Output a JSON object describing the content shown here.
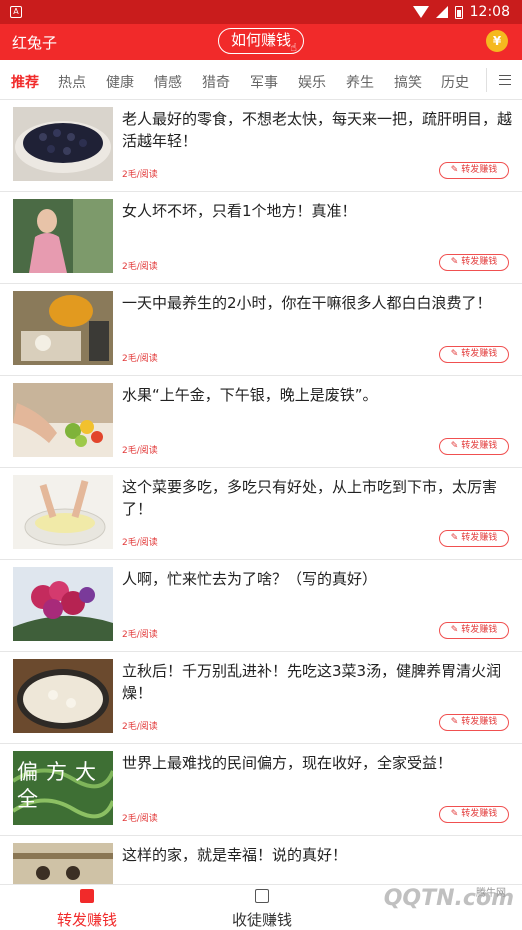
{
  "status": {
    "time": "12:08"
  },
  "appbar": {
    "title": "红兔子",
    "how_label": "如何赚钱",
    "coin_icon": "yen-coin-icon",
    "coin_glyph": "¥"
  },
  "tabs": [
    "推荐",
    "热点",
    "健康",
    "情感",
    "猎奇",
    "军事",
    "娱乐",
    "养生",
    "搞笑",
    "历史"
  ],
  "active_tab": "推荐",
  "feed": [
    {
      "title": "老人最好的零食，不想老太快，每天来一把，疏肝明目，越活越年轻！",
      "meta": "2毛/阅读",
      "share": "转发赚钱"
    },
    {
      "title": "女人坏不坏，只看1个地方！真准！",
      "meta": "2毛/阅读",
      "share": "转发赚钱"
    },
    {
      "title": "一天中最养生的2小时，你在干嘛很多人都白白浪费了！",
      "meta": "2毛/阅读",
      "share": "转发赚钱"
    },
    {
      "title": "水果“上午金，下午银，晚上是废铁”。",
      "meta": "2毛/阅读",
      "share": "转发赚钱"
    },
    {
      "title": "这个菜要多吃，多吃只有好处，从上市吃到下市，太厉害了！",
      "meta": "2毛/阅读",
      "share": "转发赚钱"
    },
    {
      "title": "人啊，忙来忙去为了啥？（写的真好）",
      "meta": "2毛/阅读",
      "share": "转发赚钱"
    },
    {
      "title": "立秋后！千万别乱进补！先吃这3菜3汤，健脾养胃清火润燥！",
      "meta": "2毛/阅读",
      "share": "转发赚钱"
    },
    {
      "title": "世界上最难找的民间偏方，现在收好，全家受益！",
      "meta": "2毛/阅读",
      "share": "转发赚钱"
    },
    {
      "title": "这样的家，就是幸福！说的真好！",
      "meta": "",
      "share": ""
    }
  ],
  "thumb_text": {
    "item8": "偏方大全"
  },
  "bottom_nav": {
    "left_label": "转发赚钱",
    "right_label": "收徒赚钱"
  },
  "watermark": {
    "text": "QQTN.com",
    "sub": "腾牛网"
  },
  "colors": {
    "brand_red": "#f12a2a",
    "status_red": "#c91c1c",
    "text": "#222222",
    "meta_red": "#e23a3a"
  }
}
